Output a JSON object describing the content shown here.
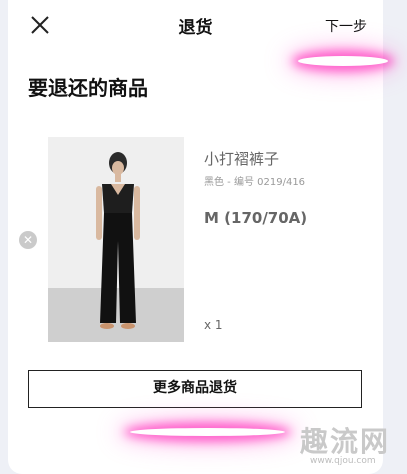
{
  "header": {
    "title": "退货",
    "next_label": "下一步"
  },
  "section_title": "要退还的商品",
  "product": {
    "name": "小打褶裤子",
    "meta": "黑色 - 编号 0219/416",
    "size": "M (170/70A)",
    "quantity": "x 1"
  },
  "more_button_label": "更多商品退货",
  "watermark": {
    "text": "趣流网",
    "url": "www.qjou.com"
  }
}
